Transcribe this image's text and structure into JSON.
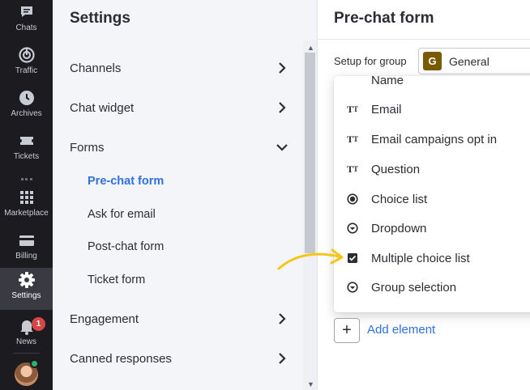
{
  "rail": {
    "items": [
      {
        "label": "Chats",
        "icon": "chat-icon"
      },
      {
        "label": "Traffic",
        "icon": "traffic-icon"
      },
      {
        "label": "Archives",
        "icon": "clock-icon"
      },
      {
        "label": "Tickets",
        "icon": "ticket-icon"
      },
      {
        "label": "Marketplace",
        "icon": "grid-icon"
      },
      {
        "label": "Billing",
        "icon": "card-icon"
      },
      {
        "label": "Settings",
        "icon": "gear-icon"
      },
      {
        "label": "News",
        "icon": "bell-icon"
      }
    ],
    "news_badge": "1",
    "active": "Settings",
    "user_status_color": "#2cb36b"
  },
  "settings": {
    "title": "Settings",
    "menu": {
      "channels": "Channels",
      "chat_widget": "Chat widget",
      "forms": "Forms",
      "engagement": "Engagement",
      "canned_responses": "Canned responses"
    },
    "forms_sub": {
      "pre_chat": "Pre-chat form",
      "ask_email": "Ask for email",
      "post_chat": "Post-chat form",
      "ticket": "Ticket form"
    }
  },
  "content": {
    "title": "Pre-chat form",
    "group_label": "Setup for group",
    "group_chip": "G",
    "group_name": "General"
  },
  "dropdown": {
    "partial_top": "Name",
    "items": [
      {
        "label": "Email",
        "icon": "text-type-icon"
      },
      {
        "label": "Email campaigns opt in",
        "icon": "text-type-icon"
      },
      {
        "label": "Question",
        "icon": "text-type-icon"
      },
      {
        "label": "Choice list",
        "icon": "radio-icon"
      },
      {
        "label": "Dropdown",
        "icon": "dropdown-circle-icon"
      },
      {
        "label": "Multiple choice list",
        "icon": "checkbox-icon"
      },
      {
        "label": "Group selection",
        "icon": "dropdown-circle-icon"
      }
    ]
  },
  "add_element": {
    "symbol": "+",
    "label": "Add element"
  },
  "colors": {
    "accent_blue": "#2f6fde",
    "rail_bg": "#1b1b20",
    "arrow_yellow": "#f5c518",
    "group_chip_bg": "#7a5a00",
    "badge_red": "#d64646"
  }
}
